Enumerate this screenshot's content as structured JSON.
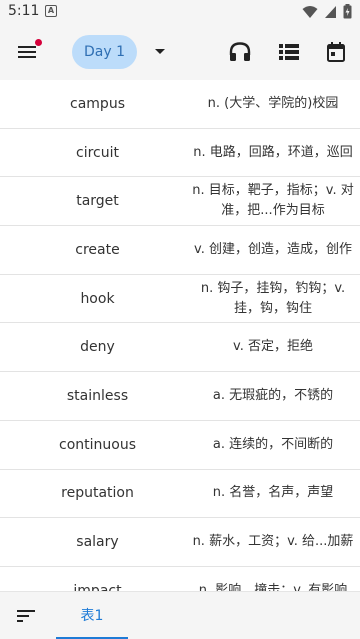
{
  "status_bar": {
    "time": "5:11",
    "app_icon_glyph": "A"
  },
  "app_bar": {
    "day_label": "Day 1"
  },
  "words": [
    {
      "word": "campus",
      "meaning": "n. (大学、学院的)校园"
    },
    {
      "word": "circuit",
      "meaning": "n. 电路，回路，环道，巡回"
    },
    {
      "word": "target",
      "meaning": "n. 目标，靶子，指标；v. 对准，把...作为目标"
    },
    {
      "word": "create",
      "meaning": "v. 创建，创造，造成，创作"
    },
    {
      "word": "hook",
      "meaning": "n. 钩子，挂钩，钓钩；v. 挂，钩，钩住"
    },
    {
      "word": "deny",
      "meaning": "v. 否定，拒绝"
    },
    {
      "word": "stainless",
      "meaning": "a. 无瑕疵的，不锈的"
    },
    {
      "word": "continuous",
      "meaning": "a. 连续的，不间断的"
    },
    {
      "word": "reputation",
      "meaning": "n. 名誉，名声，声望"
    },
    {
      "word": "salary",
      "meaning": "n. 薪水，工资；v. 给...加薪"
    },
    {
      "word": "impact",
      "meaning": "n. 影响，撞击；v. 有影响"
    }
  ],
  "bottom_bar": {
    "tab_label": "表1"
  },
  "colors": {
    "accent": "#1e7bd6",
    "pill_bg": "#bcdcfa",
    "badge": "#d5003a"
  }
}
